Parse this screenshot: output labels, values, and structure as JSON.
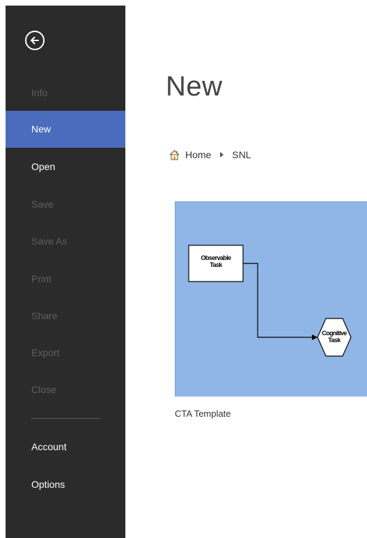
{
  "sidebar": {
    "back_icon": "back-arrow-circle-icon",
    "items": [
      {
        "label": "Info",
        "enabled": false
      },
      {
        "label": "New",
        "enabled": true,
        "selected": true
      },
      {
        "label": "Open",
        "enabled": true
      },
      {
        "label": "Save",
        "enabled": false
      },
      {
        "label": "Save As",
        "enabled": false
      },
      {
        "label": "Print",
        "enabled": false
      },
      {
        "label": "Share",
        "enabled": false
      },
      {
        "label": "Export",
        "enabled": false
      },
      {
        "label": "Close",
        "enabled": false
      }
    ],
    "bottom_items": [
      {
        "label": "Account",
        "enabled": true
      },
      {
        "label": "Options",
        "enabled": true
      }
    ]
  },
  "main": {
    "title": "New",
    "breadcrumb": {
      "home_icon": "home-icon",
      "items": [
        "Home",
        "SNL"
      ]
    },
    "templates": [
      {
        "name": "CTA Template",
        "thumbnail": {
          "shape1_label_line1": "Observable",
          "shape1_label_line2": "Task",
          "shape2_label_line1": "Cognitive",
          "shape2_label_line2": "Task"
        }
      }
    ]
  },
  "colors": {
    "sidebar_bg": "#2b2b2b",
    "selected_bg": "#4b6bbd",
    "thumbnail_bg": "#8fb6e6",
    "disabled_text": "#5f5f5f"
  }
}
